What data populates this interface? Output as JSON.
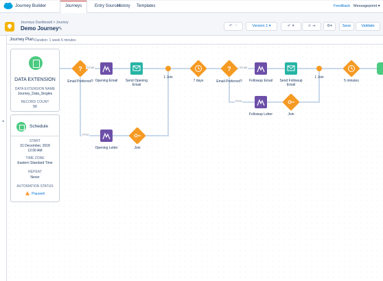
{
  "app": {
    "title": "Journey Builder"
  },
  "nav": {
    "tabs": [
      "Journeys",
      "Entry Sources",
      "History",
      "Templates"
    ],
    "feedback": "Feedback",
    "user": "Messagepoint"
  },
  "header": {
    "breadcrumb": "Journeys Dashboard  >  Journey",
    "journey_name": "Demo Journey",
    "version": "Version 1",
    "save": "Save",
    "validate": "Validate"
  },
  "plan": {
    "title": "Journey Plan",
    "duration": "Duration: 1 week 5 minutes"
  },
  "data_extension": {
    "title": "DATA EXTENSION",
    "name_label": "DATA EXTENSION NAME",
    "name_value": "Journey_Data_Singles",
    "count_label": "RECORD COUNT",
    "count_value": "50"
  },
  "schedule": {
    "title": "Schedule",
    "start_label": "START",
    "start_date": "31 December, 2018",
    "start_time": "12:00 AM",
    "tz_label": "TIME ZONE",
    "tz_value": "Eastern Standard Time",
    "repeat_label": "REPEAT",
    "repeat_value": "Never",
    "status_label": "AUTOMATION STATUS",
    "status_value": "Paused"
  },
  "flow": {
    "labels": {
      "email_preferred_1": "Email Preferred?",
      "opening_email": "Opening Email",
      "send_opening_email": "Send Opening Email",
      "join_1": "1 Join",
      "wait_7days": "7 days",
      "email_preferred_2": "Email Preferred?",
      "followup_email": "Followup Email",
      "send_followup_email": "Send Followup Email",
      "join_2": "1 Join",
      "wait_5min": "5 minutes",
      "opening_letter": "Opening Letter",
      "join_letter_1": "Join",
      "followup_letter": "Followup Letter",
      "join_letter_2": "Join",
      "path_email_1": "Email",
      "path_print_1": "Print",
      "path_email_2": "Email",
      "path_print_2": "Print"
    }
  },
  "colors": {
    "decision": "#f59a23",
    "email": "#6c4fa8",
    "send": "#26b4a4",
    "connector": "#c9d8ea",
    "entry": "#4bca81"
  }
}
